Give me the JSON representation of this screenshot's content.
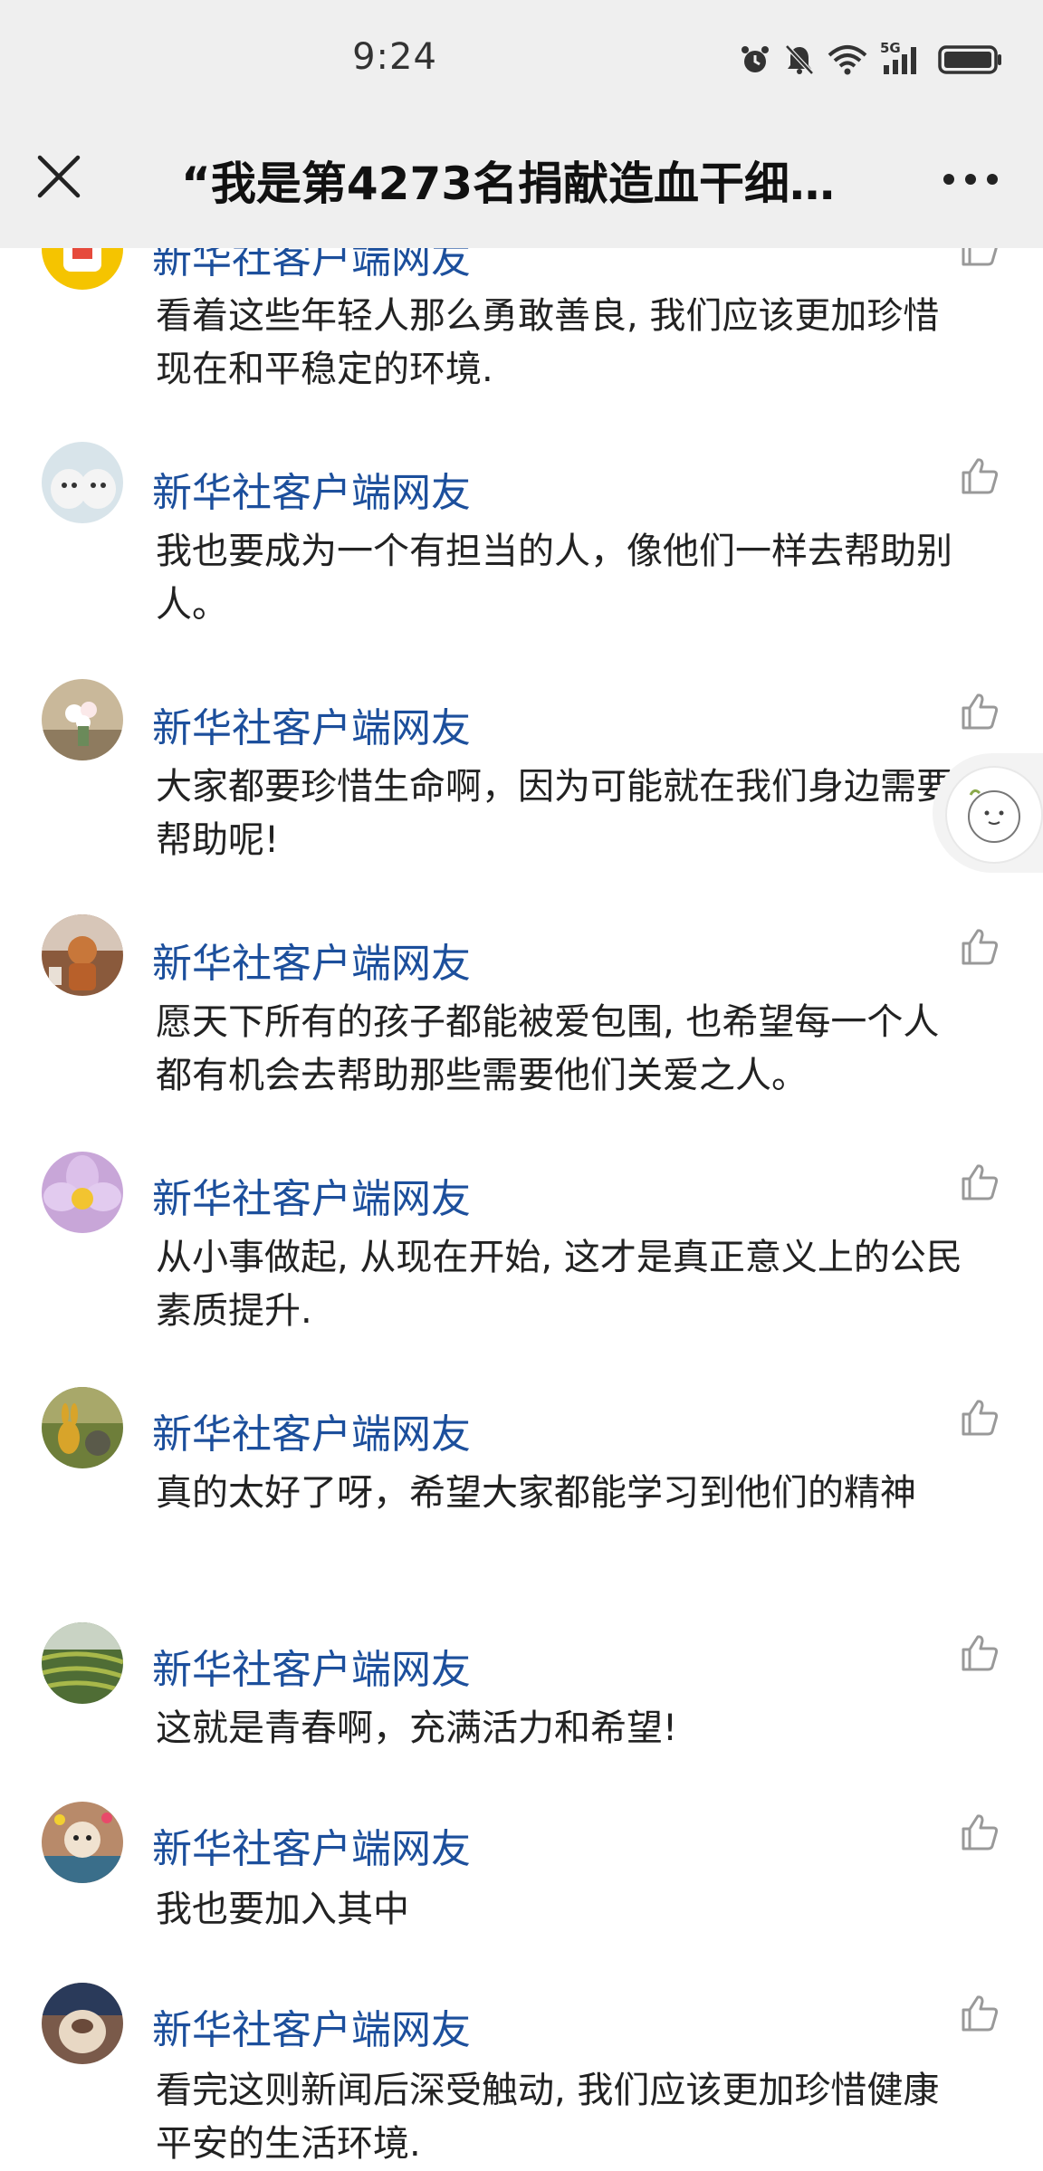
{
  "status_bar": {
    "time": "9:24",
    "icons": [
      "alarm-icon",
      "mute-icon",
      "wifi-icon",
      "5g-signal-icon",
      "battery-icon"
    ],
    "network_label": "5G"
  },
  "header": {
    "title": "“我是第4273名捐献造血干细…",
    "close_icon": "close-icon",
    "more_icon": "more-icon"
  },
  "comments": [
    {
      "author": "新华社客户端网友",
      "text": "看着这些年轻人那么勇敢善良, 我们应该更加珍惜现在和平稳定的环境.",
      "avatar_color": "#f5c400"
    },
    {
      "author": "新华社客户端网友",
      "text": "我也要成为一个有担当的人，像他们一样去帮助别人。",
      "avatar_color": "#d8e4ea"
    },
    {
      "author": "新华社客户端网友",
      "text": "大家都要珍惜生命啊，因为可能就在我们身边需要帮助呢!",
      "avatar_color": "#c9b89a"
    },
    {
      "author": "新华社客户端网友",
      "text": "愿天下所有的孩子都能被爱包围, 也希望每一个人都有机会去帮助那些需要他们关爱之人。",
      "avatar_color": "#8a5a3c"
    },
    {
      "author": "新华社客户端网友",
      "text": "从小事做起, 从现在开始, 这才是真正意义上的公民素质提升.",
      "avatar_color": "#c8a6d8"
    },
    {
      "author": "新华社客户端网友",
      "text": "真的太好了呀，希望大家都能学习到他们的精神",
      "avatar_color": "#6e7e3a"
    },
    {
      "author": "新华社客户端网友",
      "text": "这就是青春啊，充满活力和希望!",
      "avatar_color": "#4f6d35"
    },
    {
      "author": "新华社客户端网友",
      "text": "我也要加入其中",
      "avatar_color": "#b88a6a"
    },
    {
      "author": "新华社客户端网友",
      "text": "看完这则新闻后深受触动, 我们应该更加珍惜健康平安的生活环境.",
      "avatar_color": "#7a5a4a"
    }
  ],
  "floating_widget": {
    "icon": "cartoon-avatar-icon"
  },
  "colors": {
    "author": "#1c4f9c",
    "topbar": "#efefef",
    "text": "#222222"
  }
}
